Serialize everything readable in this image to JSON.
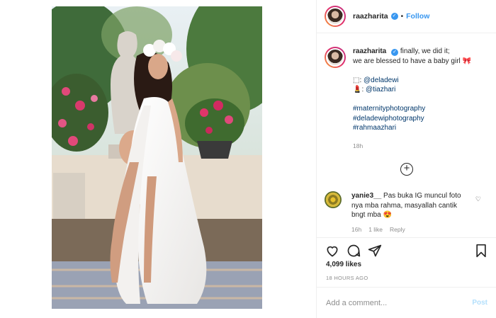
{
  "header": {
    "username": "raazharita",
    "separator": "•",
    "follow_label": "Follow",
    "verified_mark": "✓"
  },
  "caption": {
    "username": "raazharita",
    "lines": [
      "finally, we did it;",
      "we are blessed to have a baby girl 🎀"
    ],
    "credit1_icon": "⬚:",
    "credit1": "@deladewi",
    "credit2_icon": "💄:",
    "credit2": "@tiazhari",
    "hashtags": [
      "#maternityphotography",
      "#deladewiphotography",
      "#rahmaazhari"
    ],
    "timestamp": "18h"
  },
  "load_more_icon": "+",
  "comment": {
    "username": "yanie3__",
    "text": "Pas buka IG muncul foto nya mba rahma, masyallah cantik bngt mba 😍",
    "age": "16h",
    "likes": "1 like",
    "reply": "Reply",
    "like_icon": "♡"
  },
  "actions": {
    "like": "heart-icon",
    "comment": "comment-icon",
    "share": "share-icon",
    "save": "bookmark-icon"
  },
  "likes_text": "4,099 likes",
  "post_age": "18 HOURS AGO",
  "add_comment": {
    "placeholder": "Add a comment...",
    "post_label": "Post"
  },
  "colors": {
    "accent": "#3897f0",
    "hashtag": "#00376b",
    "muted": "#8e8e8e",
    "post_disabled": "#b2dffc"
  }
}
